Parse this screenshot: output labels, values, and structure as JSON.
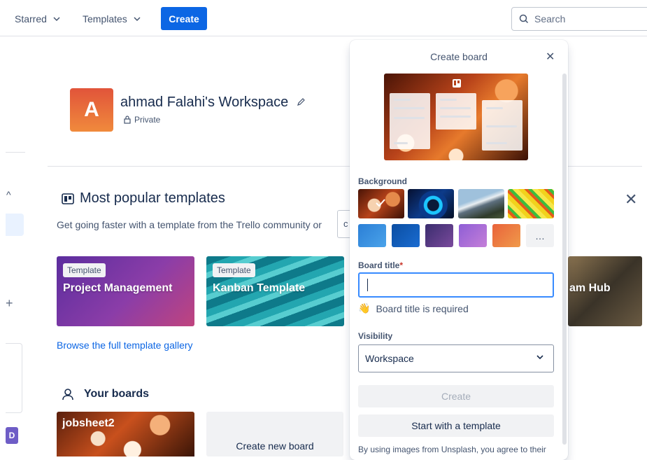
{
  "topbar": {
    "starred": "Starred",
    "templates": "Templates",
    "create": "Create",
    "search_placeholder": "Search"
  },
  "workspace": {
    "avatar_letter": "A",
    "name": "ahmad Falahi's Workspace",
    "privacy": "Private"
  },
  "templates_section": {
    "title": "Most popular templates",
    "description": "Get going faster with a template from the Trello community or",
    "category_stub": "c",
    "cards": [
      {
        "badge": "Template",
        "title": "Project Management"
      },
      {
        "badge": "Template",
        "title": "Kanban Template"
      },
      {
        "badge": "",
        "title": "am Hub"
      }
    ],
    "browse_link": "Browse the full template gallery"
  },
  "your_boards": {
    "title": "Your boards",
    "boards": [
      {
        "name": "jobsheet2"
      }
    ],
    "create_new": "Create new board"
  },
  "create_board_popover": {
    "title": "Create board",
    "background_label": "Background",
    "more_label": "…",
    "board_title_label": "Board title",
    "required_marker": "*",
    "board_title_value": "",
    "validation_message": "Board title is required",
    "validation_emoji": "👋",
    "visibility_label": "Visibility",
    "visibility_value": "Workspace",
    "create_button": "Create",
    "template_button": "Start with a template",
    "legal_text": "By using images from Unsplash, you agree to their",
    "colors": [
      "#2b7fd6",
      "#0b4ea2",
      "#5b3b8c",
      "#a56dd4",
      "#e9633b"
    ]
  },
  "left_icon_letter": "D"
}
